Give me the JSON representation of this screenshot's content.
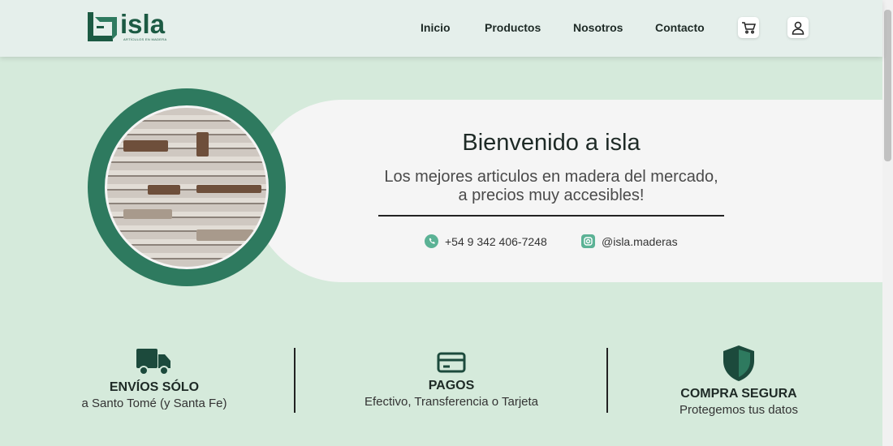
{
  "header": {
    "logo_text": "isla",
    "logo_sub": "ARTÍCULOS EN MADERA",
    "nav": [
      "Inicio",
      "Productos",
      "Nosotros",
      "Contacto"
    ],
    "icons": [
      "cart-icon",
      "user-icon"
    ]
  },
  "hero": {
    "title": "Bienvenido a isla",
    "subtitle": "Los mejores articulos en madera del mercado, a precios muy accesibles!",
    "phone": "+54 9 342 406-7248",
    "instagram": "@isla.maderas"
  },
  "features": [
    {
      "title": "ENVÍOS SÓLO",
      "desc": "a Santo Tomé (y Santa Fe)",
      "icon": "truck-icon"
    },
    {
      "title": "PAGOS",
      "desc": "Efectivo, Transferencia o Tarjeta",
      "icon": "credit-card-icon"
    },
    {
      "title": "COMPRA SEGURA",
      "desc": "Protegemos tus datos",
      "icon": "shield-icon"
    }
  ],
  "colors": {
    "primary": "#1c5a43",
    "ring": "#2e7a5f",
    "background": "#d5eadb"
  }
}
